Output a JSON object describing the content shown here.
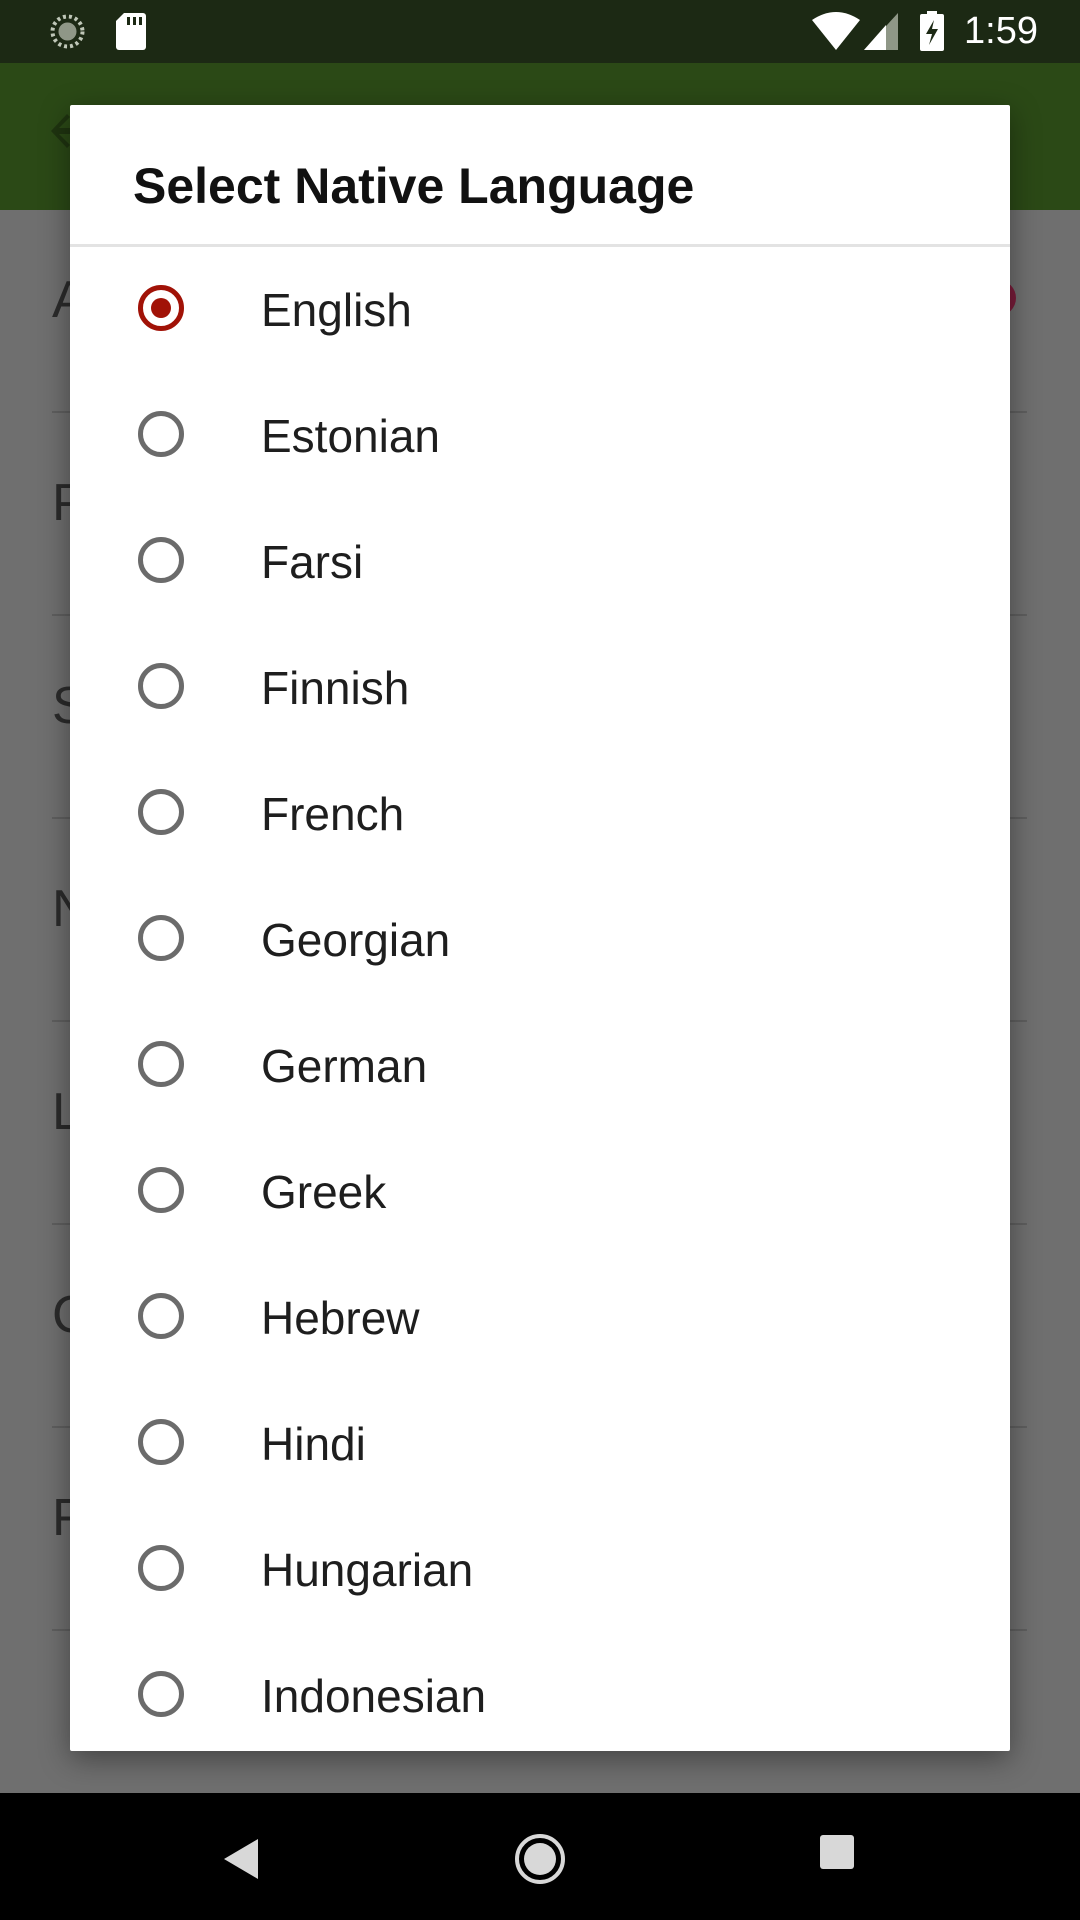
{
  "status_bar": {
    "time": "1:59",
    "icons": [
      "loading-icon",
      "sd-card-icon",
      "wifi-icon",
      "cell-signal-icon",
      "battery-charging-icon"
    ]
  },
  "app_bar": {
    "icons": [
      "back-arrow-icon"
    ],
    "colors": {
      "background": "#2b4916"
    }
  },
  "background_list": {
    "row_initials": [
      "A",
      "P",
      "S",
      "N",
      "L",
      "C",
      "F"
    ]
  },
  "dialog": {
    "title": "Select Native Language",
    "selected": "English",
    "options": [
      {
        "label": "English",
        "checked": true
      },
      {
        "label": "Estonian",
        "checked": false
      },
      {
        "label": "Farsi",
        "checked": false
      },
      {
        "label": "Finnish",
        "checked": false
      },
      {
        "label": "French",
        "checked": false
      },
      {
        "label": "Georgian",
        "checked": false
      },
      {
        "label": "German",
        "checked": false
      },
      {
        "label": "Greek",
        "checked": false
      },
      {
        "label": "Hebrew",
        "checked": false
      },
      {
        "label": "Hindi",
        "checked": false
      },
      {
        "label": "Hungarian",
        "checked": false
      },
      {
        "label": "Indonesian",
        "checked": false
      }
    ],
    "colors": {
      "accent": "#a11207",
      "radio_unchecked": "#6b6b6b"
    }
  },
  "nav_bar": {
    "icons": [
      "nav-back-icon",
      "nav-home-icon",
      "nav-recents-icon"
    ]
  }
}
